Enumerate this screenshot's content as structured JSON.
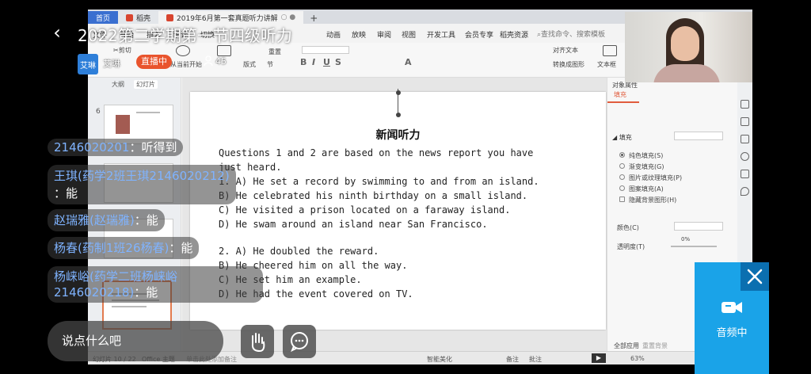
{
  "window_tabs": {
    "home": "首页",
    "docer": "稻壳",
    "doc": "2019年6月第一套真题听力讲解"
  },
  "menu": [
    "文件",
    "开始",
    "插入",
    "设计",
    "切换",
    "动画",
    "放映",
    "审阅",
    "视图",
    "开发工具",
    "会员专享",
    "稻壳资源"
  ],
  "search_placeholder": "查找命令、搜索模板",
  "ribbon": {
    "cut": "剪切",
    "start": "从当前开始",
    "layout": "版式",
    "section": "节",
    "reset": "重置",
    "align_text": "对齐文本",
    "convert_smartart": "转换成图形",
    "textbox": "文本框"
  },
  "slide_pane": {
    "tab_outline": "大纲",
    "tab_slides": "幻灯片",
    "thumb_number": "6"
  },
  "slide": {
    "title": "新闻听力",
    "lines": [
      "Questions 1 and 2 are based on the news report you have",
      "just heard.",
      "1. A) He set a record by swimming to and from an island.",
      "   B) He celebrated his ninth birthday on a small island.",
      "   C) He visited a prison located on a faraway island.",
      "   D) He swam around an island near San Francisco.",
      "2. A) He doubled the reward.",
      "   B) He cheered him on all the way.",
      "   C) He set him an example.",
      "   D) He had the event covered on TV."
    ]
  },
  "task_pane": {
    "header": "对象属性",
    "tab_fill": "填充",
    "section": "填充",
    "options": [
      "纯色填充(S)",
      "渐变填充(G)",
      "图片或纹理填充(P)",
      "图案填充(A)",
      "隐藏背景图形(H)"
    ],
    "color_label": "颜色(C)",
    "transparency_label": "透明度(T)",
    "transparency_value": "0%",
    "apply_all": "全部应用",
    "reset_bg": "重置背景"
  },
  "statusbar": {
    "slide_counter": "幻灯片 10 / 22",
    "theme": "Office 主题",
    "notes_hint": "单击此处添加备注",
    "beautify": "智能美化",
    "notes": "备注",
    "comments": "批注",
    "zoom": "63%"
  },
  "live": {
    "title": "2022第二学期第一节四级听力",
    "host_avatar": "艾琳",
    "host_name": "艾琳",
    "badge": "直播中",
    "viewers": "45"
  },
  "danmu": [
    {
      "who": "2146020201",
      "msg": "：听得到"
    },
    {
      "who": "王琪(药学2班王琪2146020212)",
      "msg": "：能"
    },
    {
      "who": "赵瑞雅(赵瑞雅)",
      "msg": "：能"
    },
    {
      "who": "杨春(药制1班26杨春)",
      "msg": "：能"
    },
    {
      "who": "杨崃峪(药学二班杨崃峪2146020218)",
      "msg": "：能"
    }
  ],
  "chat_placeholder": "说点什么吧",
  "audio_button": "音频中"
}
